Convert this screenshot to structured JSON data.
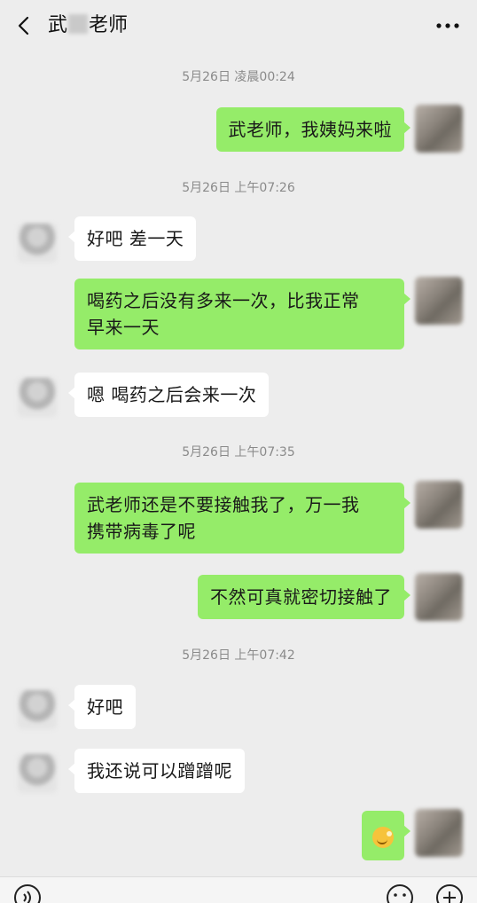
{
  "header": {
    "title_prefix": "武",
    "title_suffix": "老师",
    "more_label": "···"
  },
  "messages": [
    {
      "type": "time",
      "text": "5月26日 凌晨00:24"
    },
    {
      "type": "msg",
      "side": "me",
      "text": "武老师，我姨妈来啦"
    },
    {
      "type": "time",
      "text": "5月26日 上午07:26"
    },
    {
      "type": "msg",
      "side": "peer",
      "text": "好吧 差一天"
    },
    {
      "type": "msg",
      "side": "me",
      "lines": [
        "喝药之后没有多来一次，比我正常",
        "早来一天"
      ]
    },
    {
      "type": "msg",
      "side": "peer",
      "text": "嗯 喝药之后会来一次"
    },
    {
      "type": "time",
      "text": "5月26日 上午07:35"
    },
    {
      "type": "msg",
      "side": "me",
      "lines": [
        "武老师还是不要接触我了，万一我",
        "携带病毒了呢"
      ]
    },
    {
      "type": "msg",
      "side": "me",
      "text": "不然可真就密切接触了"
    },
    {
      "type": "time",
      "text": "5月26日 上午07:42"
    },
    {
      "type": "msg",
      "side": "peer",
      "text": "好吧"
    },
    {
      "type": "msg",
      "side": "peer",
      "text": "我还说可以蹭蹭呢"
    },
    {
      "type": "msg",
      "side": "me",
      "emoji": "smirk-emoji"
    }
  ],
  "icons": {
    "back": "chevron-left-icon",
    "more": "more-dots-icon",
    "voice": "voice-icon",
    "emoji": "emoji-face-icon",
    "plus": "plus-icon"
  },
  "colors": {
    "background": "#ededed",
    "bubble_me": "#95ec69",
    "bubble_peer": "#ffffff",
    "timestamp": "#8a8a8a"
  }
}
